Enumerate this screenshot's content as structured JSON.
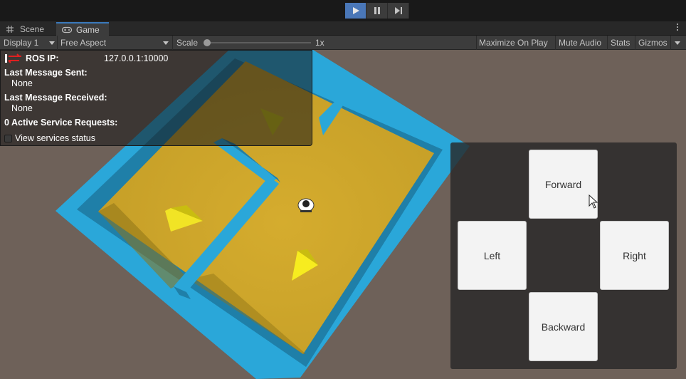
{
  "toolbar": {
    "play_icon": "play-icon",
    "pause_icon": "pause-icon",
    "step_icon": "step-icon",
    "accent_color": "#4a77b8"
  },
  "tabs": [
    {
      "label": "Scene",
      "icon": "hash-grid-icon",
      "active": false
    },
    {
      "label": "Game",
      "icon": "gamepad-icon",
      "active": true
    }
  ],
  "game_toolbar": {
    "display": "Display 1",
    "aspect": "Free Aspect",
    "scale_label": "Scale",
    "scale_value": "1x",
    "scale_level": 0.0,
    "maximize_on_play": "Maximize On Play",
    "mute_audio": "Mute Audio",
    "stats": "Stats",
    "gizmos": "Gizmos"
  },
  "ros_hud": {
    "ip_label": "ROS IP:",
    "ip_value": "127.0.0.1:10000",
    "last_sent_label": "Last Message Sent:",
    "last_sent_value": "None",
    "last_received_label": "Last Message Received:",
    "last_received_value": "None",
    "active_requests": "0 Active Service Requests:",
    "view_services": "View services status",
    "view_services_checked": false,
    "status_icon": "connection-arrows-icon",
    "status_color": "#e02020"
  },
  "controls": {
    "forward": "Forward",
    "left": "Left",
    "right": "Right",
    "backward": "Backward"
  },
  "scene": {
    "floor_color": "#c9a32c",
    "wall_color": "#2aa7d9",
    "ground_color": "#6e6159"
  }
}
